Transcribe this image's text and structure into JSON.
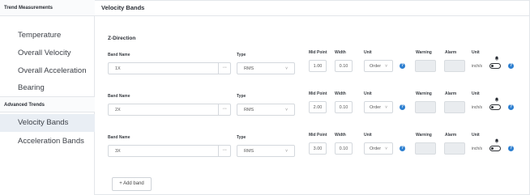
{
  "sidebar": {
    "group1_title": "Trend Measurements",
    "group1_items": [
      "Temperature",
      "Overall Velocity",
      "Overall Acceleration",
      "Bearing"
    ],
    "group2_title": "Advanced Trends",
    "group2_items": [
      "Velocity Bands",
      "Acceleration Bands"
    ],
    "active_item": "Velocity Bands"
  },
  "main": {
    "title": "Velocity Bands",
    "section": "Z-Direction",
    "labels": {
      "band_name": "Band Name",
      "type": "Type",
      "mid_point": "Mid Point",
      "width": "Width",
      "unit": "Unit",
      "warning": "Warning",
      "alarm": "Alarm",
      "unit2": "Unit"
    },
    "dots": "···",
    "info_glyph": "?",
    "bands": [
      {
        "name": "1X",
        "type": "RMS",
        "mid_point": "1.00",
        "width": "0.10",
        "unit": "Order",
        "unit2": "inch/s",
        "warning": "",
        "alarm": ""
      },
      {
        "name": "2X",
        "type": "RMS",
        "mid_point": "2.00",
        "width": "0.10",
        "unit": "Order",
        "unit2": "inch/s",
        "warning": "",
        "alarm": ""
      },
      {
        "name": "3X",
        "type": "RMS",
        "mid_point": "3.00",
        "width": "0.10",
        "unit": "Order",
        "unit2": "inch/s",
        "warning": "",
        "alarm": ""
      }
    ],
    "add_button": "+ Add band"
  },
  "icons": {
    "more": "more-dots-icon",
    "dropdown": "chevron-down-icon",
    "info": "info-icon",
    "bell": "bell-icon",
    "toggle": "toggle-switch"
  },
  "colors": {
    "accent": "#2d7fd0",
    "active_bg": "#e9eef4",
    "border": "#e3e6ea",
    "disabled_fill": "#e9ecef"
  }
}
